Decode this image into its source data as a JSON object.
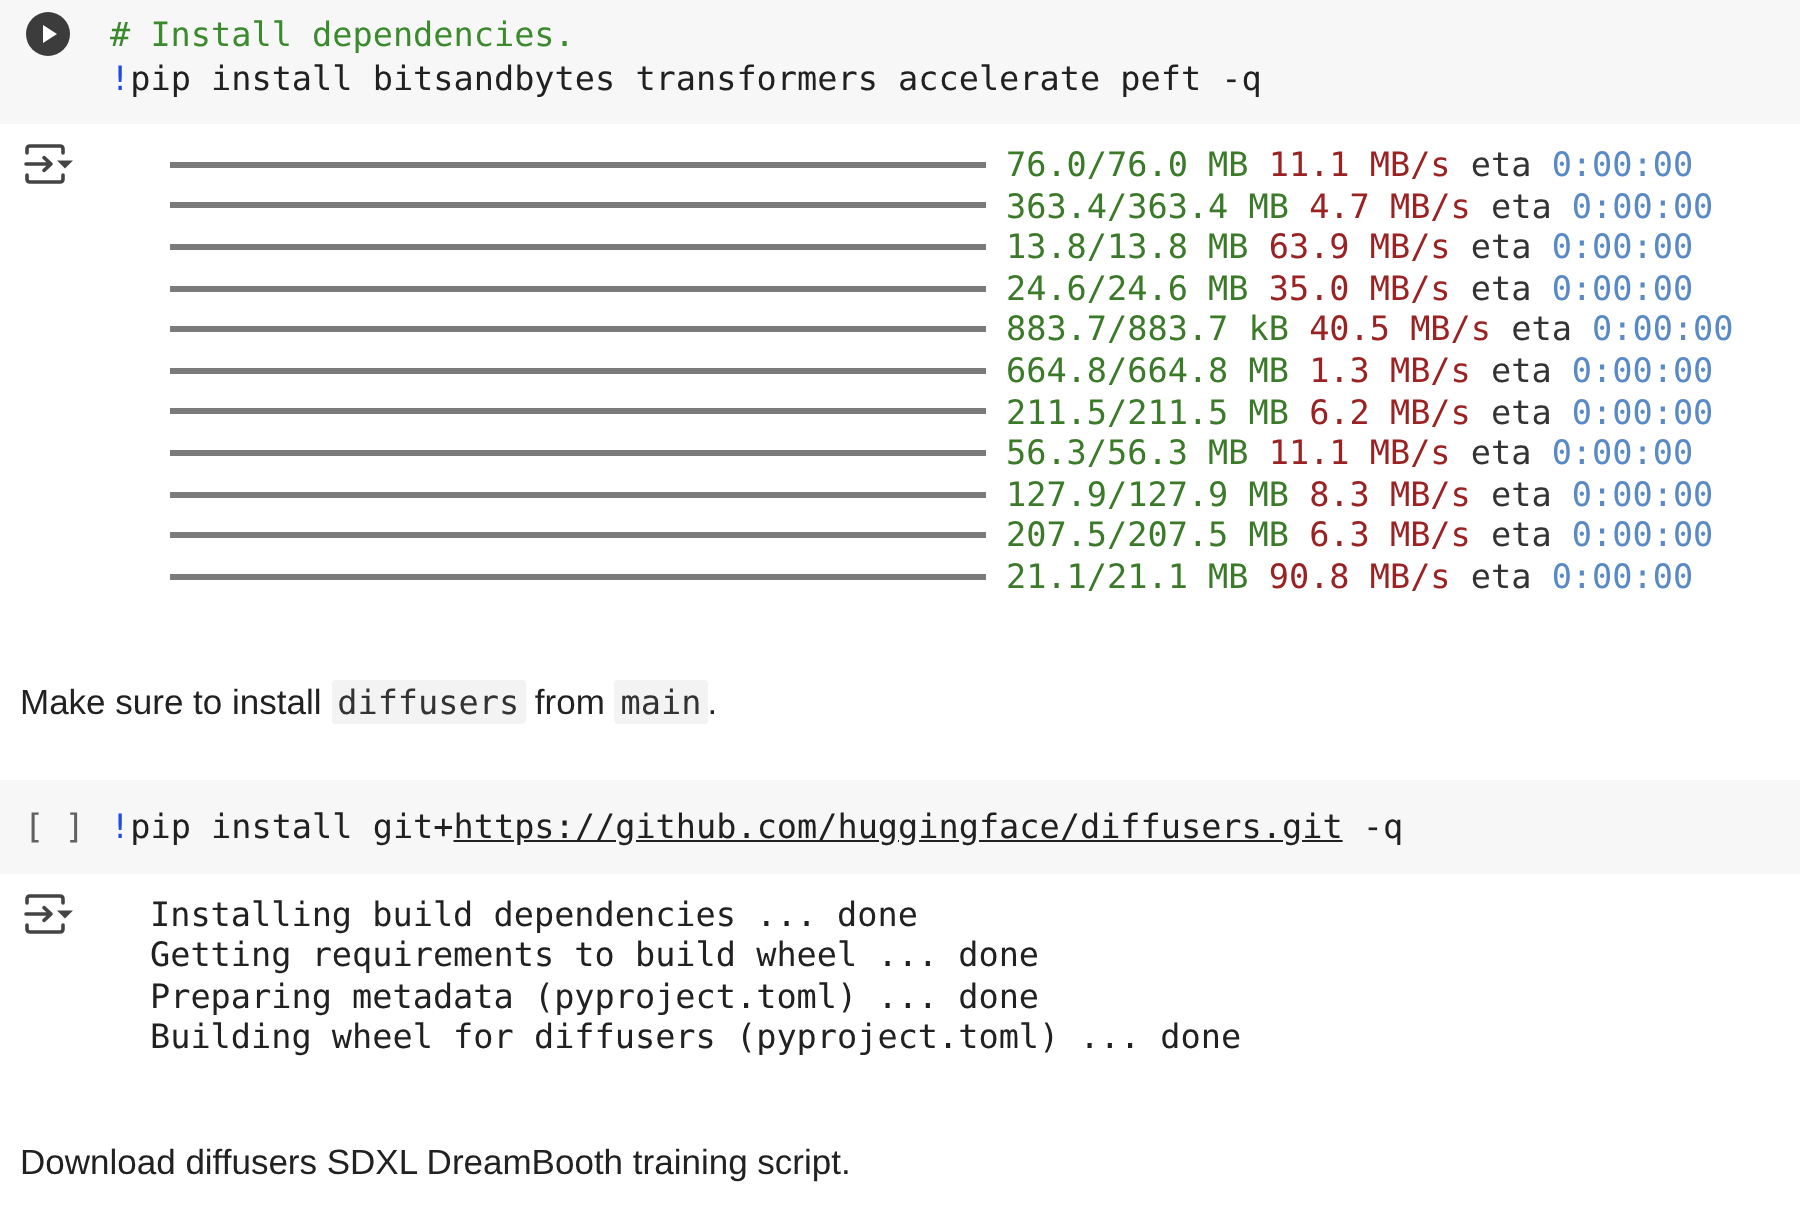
{
  "cells": [
    {
      "kind": "code",
      "focused": true,
      "lines": [
        [
          {
            "kind": "comment",
            "text": "# Install dependencies."
          }
        ],
        [
          {
            "kind": "magic",
            "text": "!"
          },
          {
            "kind": "plain",
            "text": "pip install bitsandbytes transformers accelerate peft -q"
          }
        ]
      ],
      "output": {
        "kind": "progress",
        "rows": [
          {
            "level": 1,
            "size": "76.0/76.0 MB",
            "speed": "11.1 MB/s",
            "eta_label": "eta",
            "eta": "0:00:00"
          },
          {
            "level": 1,
            "size": "363.4/363.4 MB",
            "speed": "4.7 MB/s",
            "eta_label": "eta",
            "eta": "0:00:00"
          },
          {
            "level": 1,
            "size": "13.8/13.8 MB",
            "speed": "63.9 MB/s",
            "eta_label": "eta",
            "eta": "0:00:00"
          },
          {
            "level": 1,
            "size": "24.6/24.6 MB",
            "speed": "35.0 MB/s",
            "eta_label": "eta",
            "eta": "0:00:00"
          },
          {
            "level": 1,
            "size": "883.7/883.7 kB",
            "speed": "40.5 MB/s",
            "eta_label": "eta",
            "eta": "0:00:00"
          },
          {
            "level": 1,
            "size": "664.8/664.8 MB",
            "speed": "1.3 MB/s",
            "eta_label": "eta",
            "eta": "0:00:00"
          },
          {
            "level": 1,
            "size": "211.5/211.5 MB",
            "speed": "6.2 MB/s",
            "eta_label": "eta",
            "eta": "0:00:00"
          },
          {
            "level": 1,
            "size": "56.3/56.3 MB",
            "speed": "11.1 MB/s",
            "eta_label": "eta",
            "eta": "0:00:00"
          },
          {
            "level": 1,
            "size": "127.9/127.9 MB",
            "speed": "8.3 MB/s",
            "eta_label": "eta",
            "eta": "0:00:00"
          },
          {
            "level": 1,
            "size": "207.5/207.5 MB",
            "speed": "6.3 MB/s",
            "eta_label": "eta",
            "eta": "0:00:00"
          },
          {
            "level": 1,
            "size": "21.1/21.1 MB",
            "speed": "90.8 MB/s",
            "eta_label": "eta",
            "eta": "0:00:00"
          }
        ]
      }
    },
    {
      "kind": "markdown",
      "paragraphs": [
        [
          {
            "kind": "text",
            "text": "Make sure to install "
          },
          {
            "kind": "code",
            "text": "diffusers"
          },
          {
            "kind": "text",
            "text": " from "
          },
          {
            "kind": "code",
            "text": "main"
          },
          {
            "kind": "text",
            "text": "."
          }
        ]
      ]
    },
    {
      "kind": "code",
      "focused": false,
      "prompt": "[ ]",
      "lines": [
        [
          {
            "kind": "magic",
            "text": "!"
          },
          {
            "kind": "plain",
            "text": "pip install git+"
          },
          {
            "kind": "link",
            "text": "https://github.com/huggingface/diffusers.git"
          },
          {
            "kind": "plain",
            "text": " -q"
          }
        ]
      ],
      "output": {
        "kind": "text",
        "lines": [
          "Installing build dependencies ... done",
          "Getting requirements to build wheel ... done",
          "Preparing metadata (pyproject.toml) ... done",
          "Building wheel for diffusers (pyproject.toml) ... done"
        ]
      }
    },
    {
      "kind": "markdown",
      "paragraphs": [
        [
          {
            "kind": "text",
            "text": "Download diffusers SDXL DreamBooth training script."
          }
        ]
      ]
    }
  ]
}
